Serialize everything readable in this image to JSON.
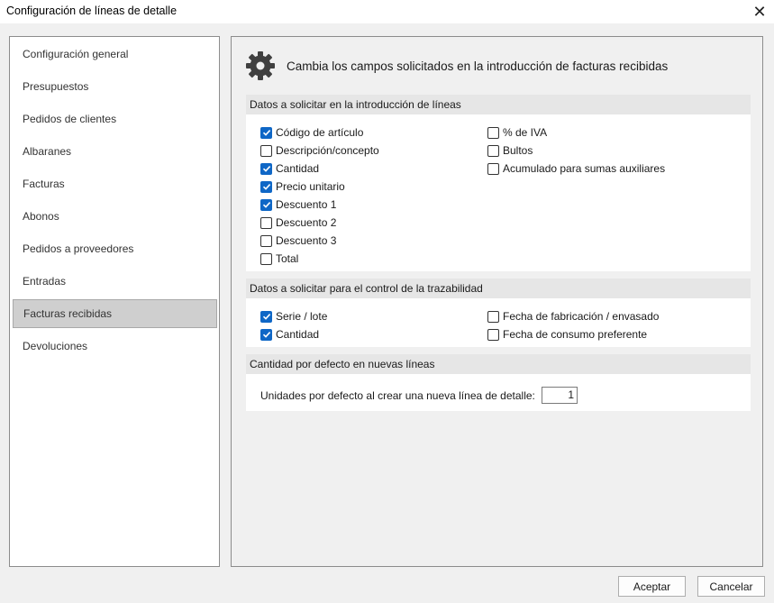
{
  "window": {
    "title": "Configuración de líneas de detalle",
    "close_icon": "close-icon"
  },
  "sidebar": {
    "items": [
      {
        "label": "Configuración general",
        "active": false
      },
      {
        "label": "Presupuestos",
        "active": false
      },
      {
        "label": "Pedidos de clientes",
        "active": false
      },
      {
        "label": "Albaranes",
        "active": false
      },
      {
        "label": "Facturas",
        "active": false
      },
      {
        "label": "Abonos",
        "active": false
      },
      {
        "label": "Pedidos a proveedores",
        "active": false
      },
      {
        "label": "Entradas",
        "active": false
      },
      {
        "label": "Facturas recibidas",
        "active": true
      },
      {
        "label": "Devoluciones",
        "active": false
      }
    ]
  },
  "main": {
    "header_icon": "gear-icon",
    "header_text": "Cambia los campos solicitados en la introducción de facturas recibidas",
    "sections": [
      {
        "title": "Datos a solicitar en la introducción de líneas",
        "col1": [
          {
            "label": "Código de artículo",
            "checked": true
          },
          {
            "label": "Descripción/concepto",
            "checked": false
          },
          {
            "label": "Cantidad",
            "checked": true
          },
          {
            "label": "Precio unitario",
            "checked": true
          },
          {
            "label": "Descuento 1",
            "checked": true
          },
          {
            "label": "Descuento 2",
            "checked": false
          },
          {
            "label": "Descuento 3",
            "checked": false
          },
          {
            "label": "Total",
            "checked": false
          }
        ],
        "col2": [
          {
            "label": "% de IVA",
            "checked": false
          },
          {
            "label": "Bultos",
            "checked": false
          },
          {
            "label": "Acumulado para sumas auxiliares",
            "checked": false
          }
        ]
      },
      {
        "title": "Datos a solicitar para el control de la trazabilidad",
        "col1": [
          {
            "label": "Serie / lote",
            "checked": true
          },
          {
            "label": "Cantidad",
            "checked": true
          }
        ],
        "col2": [
          {
            "label": "Fecha de fabricación / envasado",
            "checked": false
          },
          {
            "label": "Fecha de consumo preferente",
            "checked": false
          }
        ]
      },
      {
        "title": "Cantidad por defecto en nuevas líneas",
        "units_label": "Unidades por defecto al crear una nueva línea de detalle:",
        "units_value": "1"
      }
    ]
  },
  "buttons": {
    "accept": "Aceptar",
    "cancel": "Cancelar"
  },
  "colors": {
    "check_accent": "#0f67c6",
    "active_nav": "#cfcfcf"
  }
}
